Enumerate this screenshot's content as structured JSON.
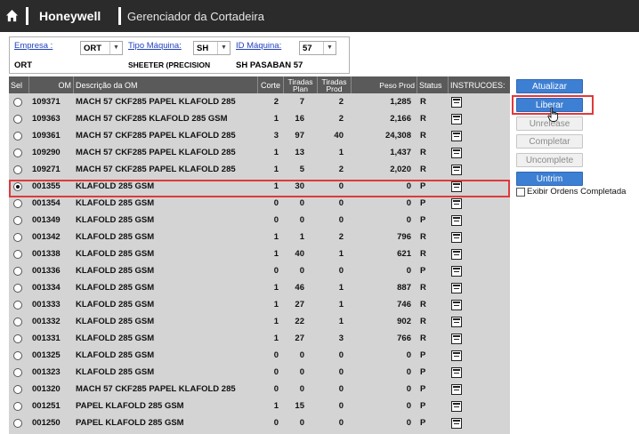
{
  "header": {
    "brand": "Honeywell",
    "title": "Gerenciador da Cortadeira"
  },
  "filters": {
    "empresa": {
      "label": "Empresa :",
      "value": "ORT",
      "display": "ORT"
    },
    "tipo_maquina": {
      "label": "Tipo Máquina:",
      "value": "SH",
      "display": "SHEETER (PRECISION"
    },
    "id_maquina": {
      "label": "ID Máquina:",
      "value": "57",
      "display": "SH PASABAN 57"
    }
  },
  "table": {
    "columns": [
      "Sel",
      "OM",
      "Descrição da OM",
      "Corte",
      "Tiradas Plan",
      "Tiradas Prod",
      "Peso Prod",
      "Status",
      "INSTRUCOES:"
    ],
    "rows": [
      {
        "om": "109371",
        "desc": "MACH 57 CKF285 PAPEL KLAFOLD 285",
        "corte": "2",
        "plan": "7",
        "prod": "2",
        "peso": "1,285",
        "status": "R",
        "selected": false
      },
      {
        "om": "109363",
        "desc": "MACH 57 CKF285 KLAFOLD 285 GSM",
        "corte": "1",
        "plan": "16",
        "prod": "2",
        "peso": "2,166",
        "status": "R",
        "selected": false
      },
      {
        "om": "109361",
        "desc": "MACH 57 CKF285 PAPEL KLAFOLD 285",
        "corte": "3",
        "plan": "97",
        "prod": "40",
        "peso": "24,308",
        "status": "R",
        "selected": false
      },
      {
        "om": "109290",
        "desc": "MACH 57 CKF285 PAPEL KLAFOLD 285",
        "corte": "1",
        "plan": "13",
        "prod": "1",
        "peso": "1,437",
        "status": "R",
        "selected": false
      },
      {
        "om": "109271",
        "desc": "MACH 57 CKF285 PAPEL KLAFOLD 285",
        "corte": "1",
        "plan": "5",
        "prod": "2",
        "peso": "2,020",
        "status": "R",
        "selected": false
      },
      {
        "om": "001355",
        "desc": "KLAFOLD 285 GSM",
        "corte": "1",
        "plan": "30",
        "prod": "0",
        "peso": "0",
        "status": "P",
        "selected": true
      },
      {
        "om": "001354",
        "desc": "KLAFOLD 285 GSM",
        "corte": "0",
        "plan": "0",
        "prod": "0",
        "peso": "0",
        "status": "P",
        "selected": false
      },
      {
        "om": "001349",
        "desc": "KLAFOLD 285 GSM",
        "corte": "0",
        "plan": "0",
        "prod": "0",
        "peso": "0",
        "status": "P",
        "selected": false
      },
      {
        "om": "001342",
        "desc": "KLAFOLD 285 GSM",
        "corte": "1",
        "plan": "1",
        "prod": "2",
        "peso": "796",
        "status": "R",
        "selected": false
      },
      {
        "om": "001338",
        "desc": "KLAFOLD 285 GSM",
        "corte": "1",
        "plan": "40",
        "prod": "1",
        "peso": "621",
        "status": "R",
        "selected": false
      },
      {
        "om": "001336",
        "desc": "KLAFOLD 285 GSM",
        "corte": "0",
        "plan": "0",
        "prod": "0",
        "peso": "0",
        "status": "P",
        "selected": false
      },
      {
        "om": "001334",
        "desc": "KLAFOLD 285 GSM",
        "corte": "1",
        "plan": "46",
        "prod": "1",
        "peso": "887",
        "status": "R",
        "selected": false
      },
      {
        "om": "001333",
        "desc": "KLAFOLD 285 GSM",
        "corte": "1",
        "plan": "27",
        "prod": "1",
        "peso": "746",
        "status": "R",
        "selected": false
      },
      {
        "om": "001332",
        "desc": "KLAFOLD 285 GSM",
        "corte": "1",
        "plan": "22",
        "prod": "1",
        "peso": "902",
        "status": "R",
        "selected": false
      },
      {
        "om": "001331",
        "desc": "KLAFOLD 285 GSM",
        "corte": "1",
        "plan": "27",
        "prod": "3",
        "peso": "766",
        "status": "R",
        "selected": false
      },
      {
        "om": "001325",
        "desc": "KLAFOLD 285 GSM",
        "corte": "0",
        "plan": "0",
        "prod": "0",
        "peso": "0",
        "status": "P",
        "selected": false
      },
      {
        "om": "001323",
        "desc": "KLAFOLD 285 GSM",
        "corte": "0",
        "plan": "0",
        "prod": "0",
        "peso": "0",
        "status": "P",
        "selected": false
      },
      {
        "om": "001320",
        "desc": "MACH 57 CKF285 PAPEL KLAFOLD 285",
        "corte": "0",
        "plan": "0",
        "prod": "0",
        "peso": "0",
        "status": "P",
        "selected": false
      },
      {
        "om": "001251",
        "desc": "PAPEL KLAFOLD 285 GSM",
        "corte": "1",
        "plan": "15",
        "prod": "0",
        "peso": "0",
        "status": "P",
        "selected": false
      },
      {
        "om": "001250",
        "desc": "PAPEL KLAFOLD 285 GSM",
        "corte": "0",
        "plan": "0",
        "prod": "0",
        "peso": "0",
        "status": "P",
        "selected": false
      }
    ]
  },
  "actions": {
    "atualizar": "Atualizar",
    "liberar": "Liberar",
    "unrelease": "Unrelease",
    "completar": "Completar",
    "uncomplete": "Uncomplete",
    "untrim": "Untrim",
    "exibir_label": "Exibir Ordens Completada"
  },
  "colors": {
    "header_bg": "#2b2b2b",
    "primary_button": "#3d7fd3",
    "highlight": "#e0393c",
    "table_bg": "#d4d4d4",
    "table_head": "#5a5a5a"
  }
}
